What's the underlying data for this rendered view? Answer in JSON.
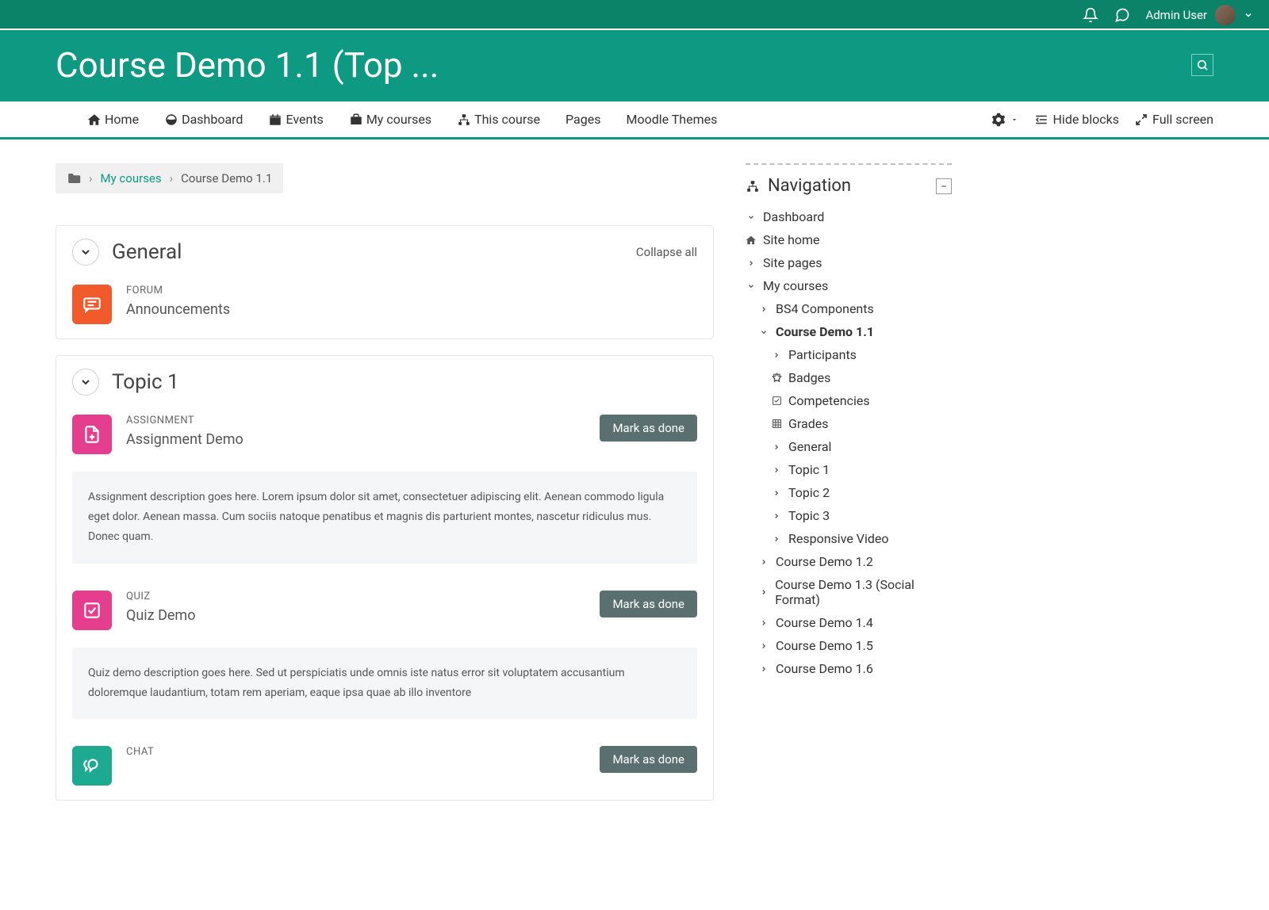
{
  "topbar": {
    "user_name": "Admin User"
  },
  "header": {
    "title": "Course Demo 1.1 (Top ..."
  },
  "navbar": {
    "items": [
      {
        "label": "Home"
      },
      {
        "label": "Dashboard"
      },
      {
        "label": "Events"
      },
      {
        "label": "My courses"
      },
      {
        "label": "This course"
      },
      {
        "label": "Pages"
      },
      {
        "label": "Moodle Themes"
      }
    ],
    "hide_blocks": "Hide blocks",
    "full_screen": "Full screen"
  },
  "breadcrumb": {
    "my_courses": "My courses",
    "current": "Course Demo 1.1"
  },
  "sections": [
    {
      "title": "General",
      "collapse_all": "Collapse all",
      "activities": [
        {
          "type": "FORUM",
          "name": "Announcements",
          "icon": "forum"
        }
      ]
    },
    {
      "title": "Topic 1",
      "activities": [
        {
          "type": "ASSIGNMENT",
          "name": "Assignment Demo",
          "icon": "assign",
          "mark": "Mark as done",
          "desc": "Assignment description goes here. Lorem ipsum dolor sit amet, consectetuer adipiscing elit. Aenean commodo ligula eget dolor. Aenean massa. Cum sociis natoque penatibus et magnis dis parturient montes, nascetur ridiculus mus. Donec quam."
        },
        {
          "type": "QUIZ",
          "name": "Quiz Demo",
          "icon": "quiz",
          "mark": "Mark as done",
          "desc": "Quiz demo description goes here. Sed ut perspiciatis unde omnis iste natus error sit voluptatem accusantium doloremque laudantium, totam rem aperiam, eaque ipsa quae ab illo inventore"
        },
        {
          "type": "CHAT",
          "name": "",
          "icon": "chat",
          "mark": "Mark as done"
        }
      ]
    }
  ],
  "nav_block": {
    "title": "Navigation",
    "items": [
      {
        "label": "Dashboard",
        "indent": 0,
        "icon": "down"
      },
      {
        "label": "Site home",
        "indent": 0,
        "icon": "home"
      },
      {
        "label": "Site pages",
        "indent": 0,
        "icon": "right"
      },
      {
        "label": "My courses",
        "indent": 0,
        "icon": "down"
      },
      {
        "label": "BS4 Components",
        "indent": 1,
        "icon": "right"
      },
      {
        "label": "Course Demo 1.1",
        "indent": 1,
        "icon": "down",
        "bold": true
      },
      {
        "label": "Participants",
        "indent": 2,
        "icon": "right"
      },
      {
        "label": "Badges",
        "indent": 2,
        "icon": "badge"
      },
      {
        "label": "Competencies",
        "indent": 2,
        "icon": "check"
      },
      {
        "label": "Grades",
        "indent": 2,
        "icon": "grid"
      },
      {
        "label": "General",
        "indent": 2,
        "icon": "right"
      },
      {
        "label": "Topic 1",
        "indent": 2,
        "icon": "right"
      },
      {
        "label": "Topic 2",
        "indent": 2,
        "icon": "right"
      },
      {
        "label": "Topic 3",
        "indent": 2,
        "icon": "right"
      },
      {
        "label": "Responsive Video",
        "indent": 2,
        "icon": "right"
      },
      {
        "label": "Course Demo 1.2",
        "indent": 1,
        "icon": "right"
      },
      {
        "label": "Course Demo 1.3 (Social Format)",
        "indent": 1,
        "icon": "right"
      },
      {
        "label": "Course Demo 1.4",
        "indent": 1,
        "icon": "right"
      },
      {
        "label": "Course Demo 1.5",
        "indent": 1,
        "icon": "right"
      },
      {
        "label": "Course Demo 1.6",
        "indent": 1,
        "icon": "right"
      }
    ]
  }
}
